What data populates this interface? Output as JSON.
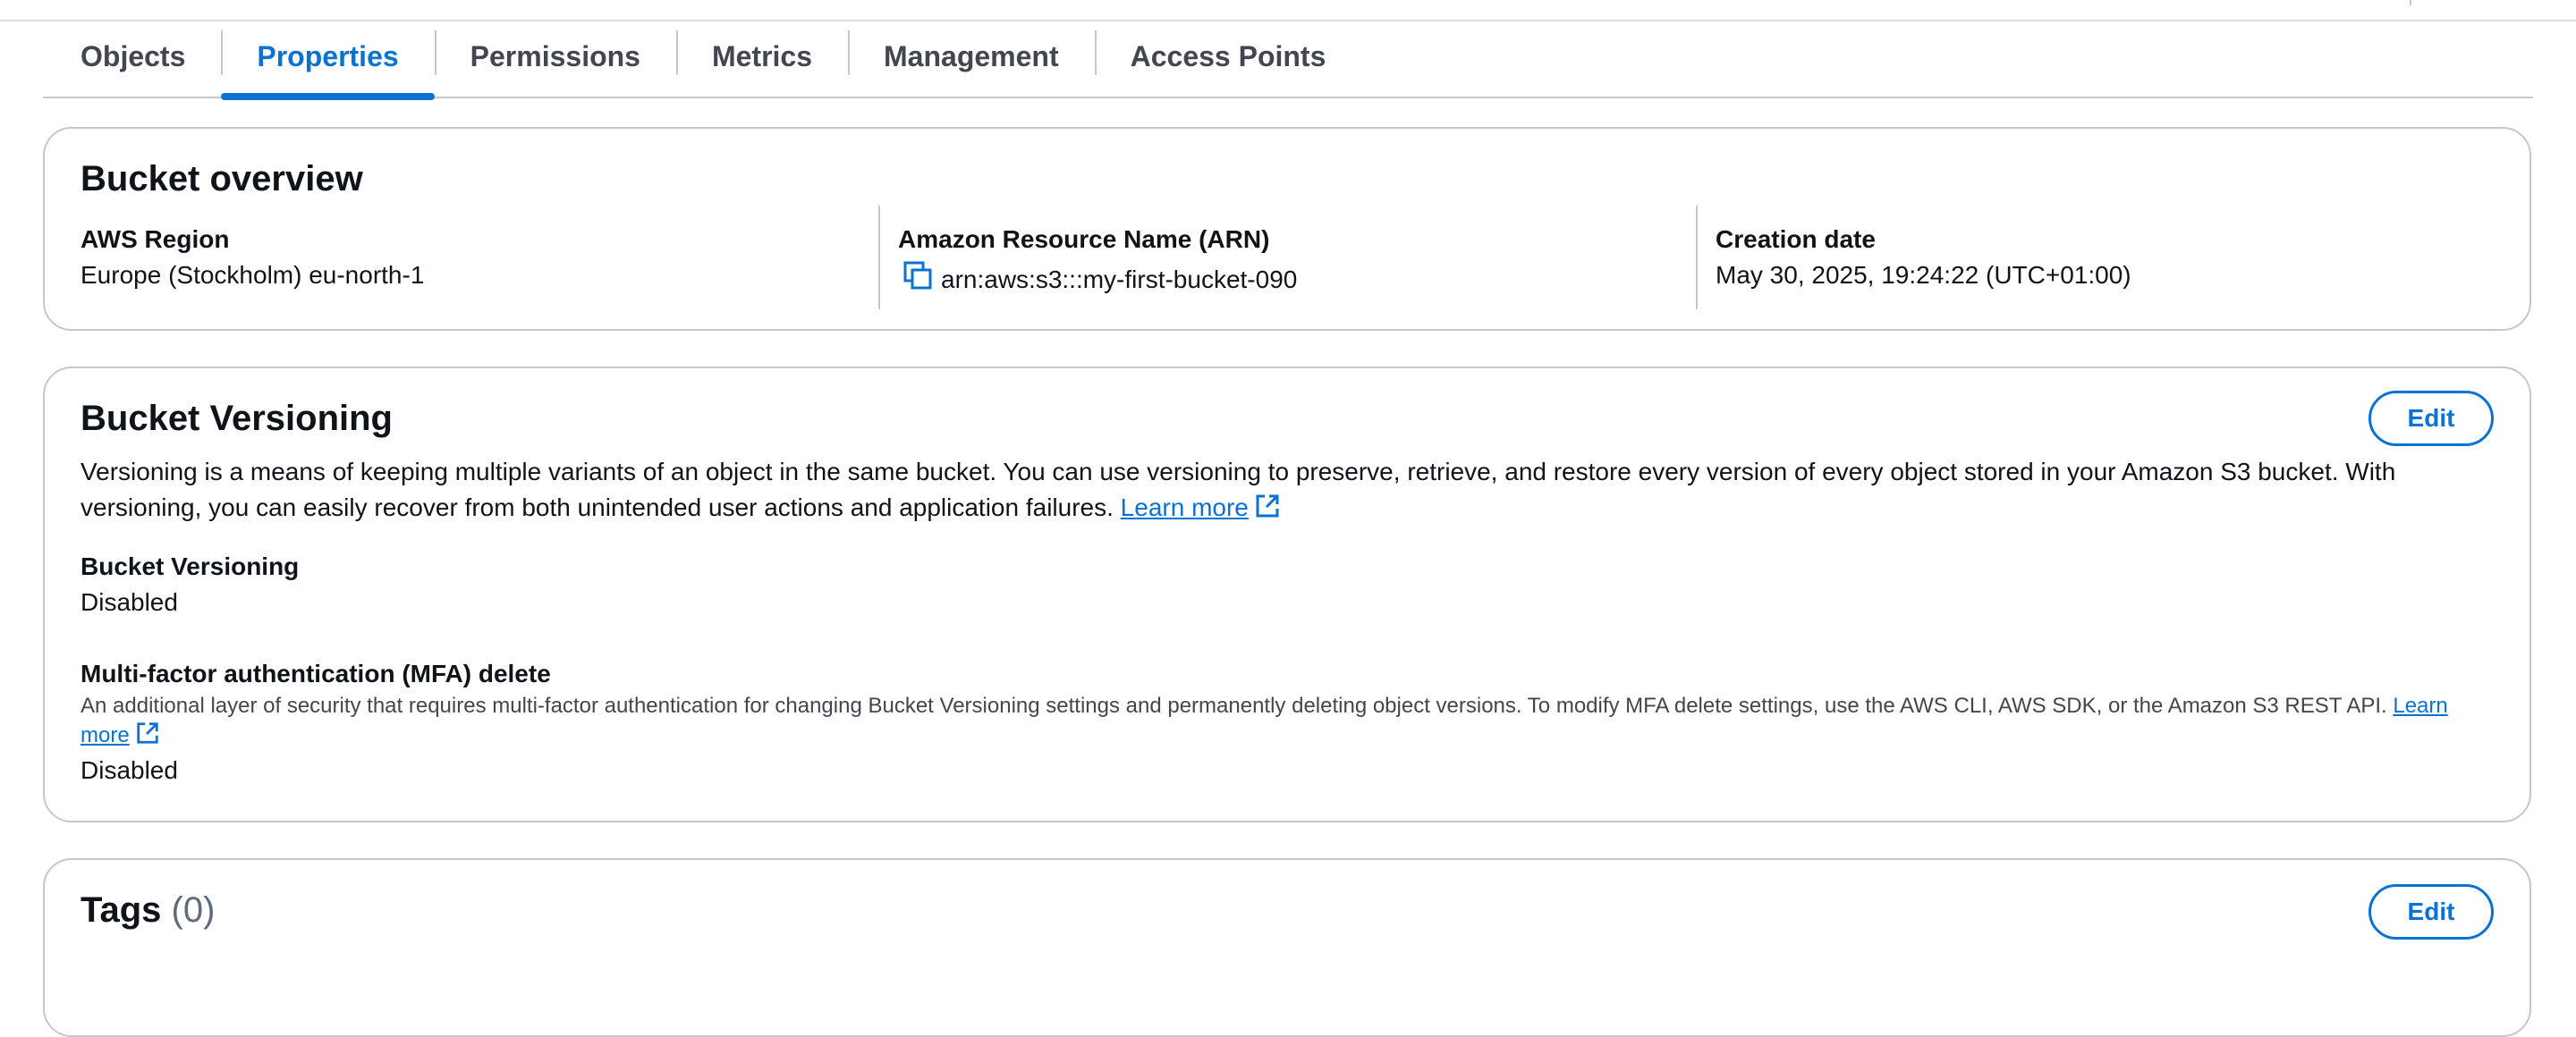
{
  "tabs": [
    {
      "label": "Objects"
    },
    {
      "label": "Properties"
    },
    {
      "label": "Permissions"
    },
    {
      "label": "Metrics"
    },
    {
      "label": "Management"
    },
    {
      "label": "Access Points"
    }
  ],
  "active_tab": "Properties",
  "overview": {
    "title": "Bucket overview",
    "region_label": "AWS Region",
    "region_value": "Europe (Stockholm) eu-north-1",
    "arn_label": "Amazon Resource Name (ARN)",
    "arn_value": "arn:aws:s3:::my-first-bucket-090",
    "created_label": "Creation date",
    "created_value": "May 30, 2025, 19:24:22 (UTC+01:00)"
  },
  "versioning": {
    "title": "Bucket Versioning",
    "edit_label": "Edit",
    "description": "Versioning is a means of keeping multiple variants of an object in the same bucket. You can use versioning to preserve, retrieve, and restore every version of every object stored in your Amazon S3 bucket. With versioning, you can easily recover from both unintended user actions and application failures.",
    "learn_more": "Learn more",
    "status_label": "Bucket Versioning",
    "status_value": "Disabled",
    "mfa_label": "Multi-factor authentication (MFA) delete",
    "mfa_description": "An additional layer of security that requires multi-factor authentication for changing Bucket Versioning settings and permanently deleting object versions. To modify MFA delete settings, use the AWS CLI, AWS SDK, or the Amazon S3 REST API.",
    "mfa_learn_more": "Learn more",
    "mfa_value": "Disabled"
  },
  "tags": {
    "title": "Tags",
    "count": "(0)",
    "edit_label": "Edit"
  },
  "colors": {
    "accent": "#0972d3",
    "annotation_arrow": "#e0241b",
    "border": "#c6c6cd"
  }
}
